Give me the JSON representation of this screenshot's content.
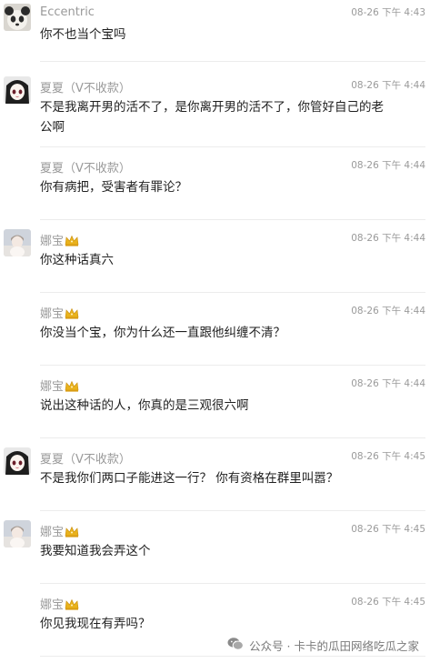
{
  "messages": [
    {
      "sender": "Eccentric",
      "crown": false,
      "avatar": "panda",
      "time": "08-26 下午 4:43",
      "lines": [
        "你不也当个宝吗"
      ]
    },
    {
      "sender": "夏夏（V不收款）",
      "crown": false,
      "avatar": "anime-girl",
      "time": "08-26 下午 4:44",
      "lines": [
        "不是我离开男的活不了，是你离开男的活不了，你管好自己的老",
        "公啊"
      ]
    },
    {
      "sender": "夏夏（V不收款）",
      "crown": false,
      "avatar": "",
      "time": "08-26 下午 4:44",
      "lines": [
        "你有病把，受害者有罪论？"
      ]
    },
    {
      "sender": "娜宝",
      "crown": true,
      "avatar": "doll",
      "time": "08-26 下午 4:44",
      "lines": [
        "你这种话真六"
      ]
    },
    {
      "sender": "娜宝",
      "crown": true,
      "avatar": "",
      "time": "08-26 下午 4:44",
      "lines": [
        "你没当个宝，你为什么还一直跟他纠缠不清？"
      ]
    },
    {
      "sender": "娜宝",
      "crown": true,
      "avatar": "",
      "time": "08-26 下午 4:44",
      "lines": [
        "说出这种话的人，你真的是三观很六啊"
      ]
    },
    {
      "sender": "夏夏（V不收款）",
      "crown": false,
      "avatar": "anime-girl",
      "time": "08-26 下午 4:45",
      "lines": [
        "不是我你们两口子能进这一行？ 你有资格在群里叫嚣？"
      ]
    },
    {
      "sender": "娜宝",
      "crown": true,
      "avatar": "doll",
      "time": "08-26 下午 4:45",
      "lines": [
        "我要知道我会弄这个"
      ]
    },
    {
      "sender": "娜宝",
      "crown": true,
      "avatar": "",
      "time": "08-26 下午 4:45",
      "lines": [
        "你见我现在有弄吗？"
      ]
    }
  ],
  "watermark": {
    "text": "公众号 · 卡卡的瓜田网络吃瓜之家",
    "icon": "wechat-icon"
  },
  "colors": {
    "name": "#9a9a9a",
    "text": "#1f1f1f",
    "separator": "#ececec",
    "crown": "#e9b21c"
  }
}
